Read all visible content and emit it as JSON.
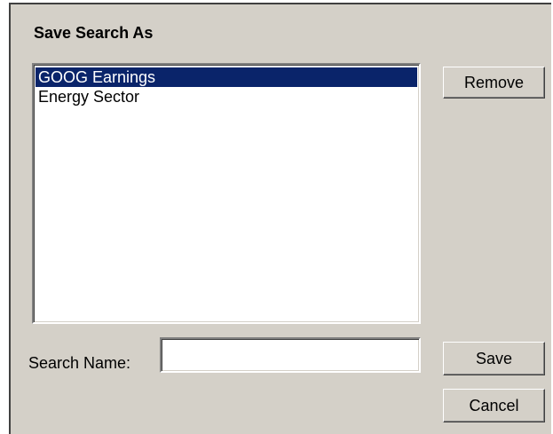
{
  "dialog": {
    "title": "Save Search As"
  },
  "saved_searches": {
    "items": [
      {
        "label": "GOOG Earnings",
        "selected": true
      },
      {
        "label": "Energy Sector",
        "selected": false
      }
    ]
  },
  "buttons": {
    "remove_label": "Remove",
    "save_label": "Save",
    "cancel_label": "Cancel"
  },
  "search_name": {
    "label": "Search Name:",
    "value": "",
    "placeholder": ""
  },
  "colors": {
    "dialog_bg": "#d4d0c8",
    "selection_bg": "#0a246a",
    "selection_text": "#ffffff"
  }
}
